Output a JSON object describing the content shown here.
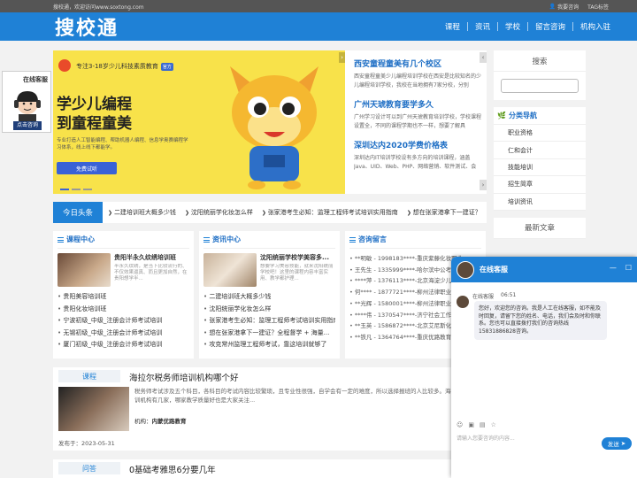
{
  "topbar": {
    "welcome": "搜校通，欢迎访问www.soxtong.com",
    "links": [
      "我要咨询",
      "TAG标签"
    ]
  },
  "header": {
    "logo": "搜校通",
    "nav": [
      "课程",
      "资讯",
      "学校",
      "留言咨询",
      "机构入驻"
    ]
  },
  "float_service": {
    "title": "在线客服",
    "button": "点击咨询"
  },
  "banner": {
    "top_text": "专注3-18岁少儿科技素质教育",
    "badge": "官方",
    "headline": [
      "学少儿编程",
      "到童程童美"
    ],
    "desc": "专业打造人工智能编程、帮助机器人编程、信息学奥赛编程学习体系，线上线下都能学。",
    "button": "免费试听"
  },
  "banner_news": [
    {
      "title": "西安童程童美有几个校区",
      "desc": "西安童程童美少儿编程培训学校在西安是比较知名的少儿编程培训学校，我校在当地拥有7家分校，分别"
    },
    {
      "title": "广州天琥教育要学多久",
      "desc": "广州学习设计可以到广州天琥教育培训学校，学校课程设置全，不同的课程学期也不一样，想要了解具"
    },
    {
      "title": "深圳达内2020学费价格表",
      "desc": "深圳达内IT培训学校设有多方向的培训课程，涵盖Java、UID、Web、PHP、网络营销、软件测试、会"
    }
  ],
  "ticker": {
    "label": "今日头条",
    "items": [
      "二建培训班大概多少钱",
      "沈阳统丽学化妆怎么样",
      "张家港考生必知：监理工程师考试培训实用指南",
      "想在张家港拿下一建证？"
    ]
  },
  "course_center": {
    "title": "课程中心",
    "featured": {
      "title": "贵阳半永久纹绣培训班",
      "desc": "半永久纹绣，是当下比较流行的、不仅效果逼真、而且更加自然，在贵阳想学半..."
    },
    "items": [
      "贵阳美容培训班",
      "贵阳化妆培训班",
      "宁波初级_中级_注册会计师考试培训",
      "无锡初级_中级_注册会计师考试培训",
      "厦门初级_中级_注册会计师考试培训"
    ]
  },
  "news_center": {
    "title": "资讯中心",
    "featured": {
      "title": "沈阳统丽学校学美容多...",
      "desc": "想要学习美容技能，就来沈阳统丽学校吧！这里的课程内容丰富实用、教学都护理..."
    },
    "items": [
      "二建培训班大概多少钱",
      "沈阳统丽学化妆怎么样",
      "张家港考生必知：监理工程师考试培训实用指南",
      "想在张家港拿下一建证？全程督学 + 海量...",
      "攻克常州监理工程师考试，靠这培训就够了"
    ]
  },
  "messages": {
    "title": "咨询留言",
    "items": [
      "**明敏 - 1998183****-重庆紫藤化妆职业...",
      "王先生 - 1335999****-哈尔滨中公考...",
      "****萍 - 1376113****-北京海淀少儿...",
      "何**** - 1877721****-柳州法律职业...",
      "**光辉 - 1580001****-柳州法律职业...",
      "****伟 - 1370547****-济宁社会工作...",
      "**玉英 - 1586872****-北京艾尼斯化...",
      "**铁凡 - 1364764****-重庆优路教育..."
    ]
  },
  "article1": {
    "tag": "课程",
    "title": "海拉尔税务师培训机构哪个好",
    "body": "税务师考试涉及五个科目，各科目的考试内容比较繁琐，且专业性很强，自学会有一定的难度，所以选择报班的人比较多。海拉尔税务师培训机构有几家，哪家教学质量好也是大家关注...",
    "org_label": "机构：",
    "org": "内蒙优路教育",
    "date_label": "发布于：",
    "date": "2023-05-31"
  },
  "article2": {
    "tag": "问答",
    "title": "0基础考雅思6分要几年"
  },
  "sidebar": {
    "search_title": "搜索",
    "nav_title": "分类导航",
    "nav_items": [
      "职业资格",
      "仁和会计",
      "技能培训",
      "招生简章",
      "培训资讯"
    ],
    "latest_title": "最新文章"
  },
  "chat": {
    "title": "在线客服",
    "agent": "在线客服",
    "time": "06:51",
    "message": "您好，欢迎您的咨询。我是人工在线客服，如不能及时回复，请留下您的姓名、电话，我们会及时和你联系。您也可以直接拨打我们的咨询热线15831886828咨询。",
    "placeholder": "请输入您要咨询的内容...",
    "send": "发送"
  },
  "colors": {
    "brand": "#1f81d6",
    "link": "#1f6fc5",
    "banner_bg": "#f8e24a"
  }
}
